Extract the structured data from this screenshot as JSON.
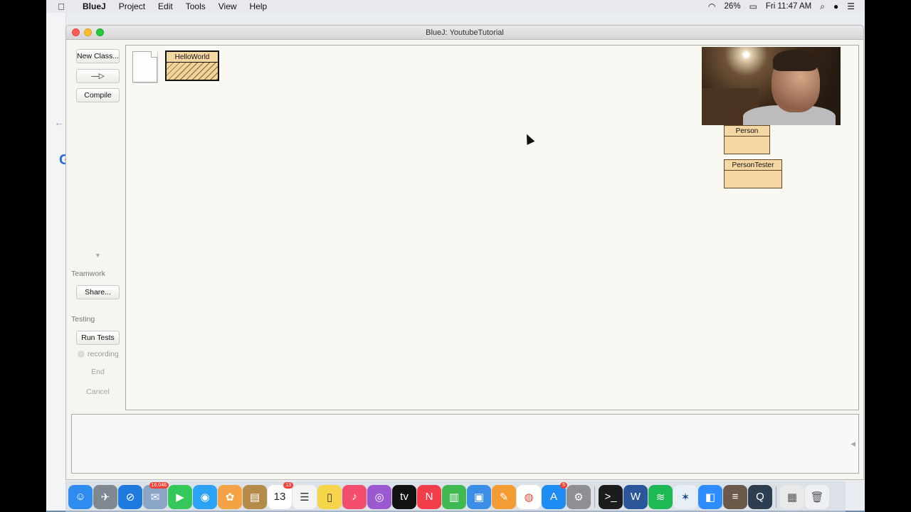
{
  "menubar": {
    "app": "BlueJ",
    "items": [
      "Project",
      "Edit",
      "Tools",
      "View",
      "Help"
    ],
    "battery": "26%",
    "clock": "Fri 11:47 AM"
  },
  "window": {
    "title": "BlueJ:  YoutubeTutorial"
  },
  "toolbar": {
    "new_class": "New Class...",
    "arrow": "—▷",
    "compile": "Compile"
  },
  "teamwork": {
    "label": "Teamwork",
    "share": "Share..."
  },
  "testing": {
    "label": "Testing",
    "run_tests": "Run Tests",
    "recording": "recording",
    "end": "End",
    "cancel": "Cancel"
  },
  "classes": [
    {
      "name": "HelloWorld",
      "compiled": false
    },
    {
      "name": "Person",
      "compiled": true
    },
    {
      "name": "PersonTester",
      "compiled": true
    }
  ],
  "dock": {
    "badges": {
      "messages": "16,046",
      "calendar": "13",
      "appstore": "5"
    },
    "icons": [
      "finder-icon",
      "launchpad-icon",
      "safari-icon",
      "mail-icon",
      "facetime-icon",
      "messages-icon",
      "photos-icon",
      "notes-brown-icon",
      "calendar-icon",
      "reminders-icon",
      "stickies-icon",
      "music-icon",
      "podcasts-icon",
      "tv-icon",
      "news-icon",
      "numbers-icon",
      "keynote-icon",
      "pages-icon",
      "chrome-icon",
      "appstore-icon",
      "system-preferences-icon",
      "terminal-icon",
      "word-icon",
      "spotify-icon",
      "bluej-icon",
      "zoom-icon",
      "screenflow-icon",
      "quicktime-icon",
      "documents-icon",
      "trash-icon"
    ]
  }
}
